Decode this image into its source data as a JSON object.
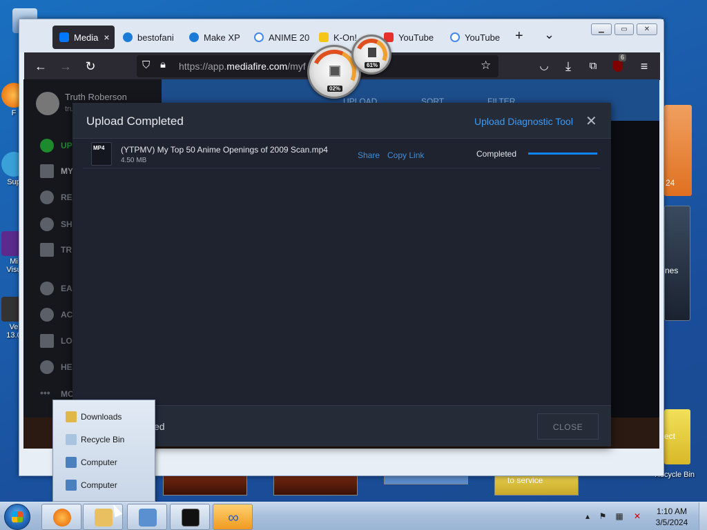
{
  "desktop": {
    "left_icons": [
      {
        "label": "Co",
        "name": "desktop-icon-computer"
      },
      {
        "label": "F",
        "name": "desktop-icon-firefox"
      },
      {
        "label": "Sup",
        "name": "desktop-icon-support"
      },
      {
        "label": "Mi\nVisu",
        "name": "desktop-icon-visual"
      },
      {
        "label": "Ve\n13.0",
        "name": "desktop-icon-ve"
      }
    ],
    "right_labels": {
      "calendar_year": "24",
      "gadget_text": "nes",
      "connect_text": "ect",
      "service_text": "to service",
      "recycle_bin": "Recycle Bin"
    }
  },
  "browser": {
    "tabs": [
      {
        "label": "Media",
        "active": true,
        "favicon_color": "#0077ff"
      },
      {
        "label": "bestofani",
        "active": false,
        "favicon_color": "#1a7bd8"
      },
      {
        "label": "Make XP",
        "active": false,
        "favicon_color": "#1a7bd8"
      },
      {
        "label": "ANIME 20",
        "active": false,
        "favicon_color": "#ffffff"
      },
      {
        "label": "K-On!",
        "active": false,
        "favicon_color": "#f5c518"
      },
      {
        "label": "YouTube",
        "active": false,
        "favicon_color": "#e8302a"
      },
      {
        "label": "YouTube",
        "active": false,
        "favicon_color": "#ffffff"
      }
    ],
    "tab_close_glyph": "×",
    "new_tab_glyph": "+",
    "list_tabs_glyph": "⌄",
    "url_prefix": "https://app.",
    "url_domain": "mediafire.com",
    "url_suffix": "/myf",
    "ublock_badge": "6",
    "window_buttons": {
      "minimize": "▁",
      "maximize": "▭",
      "close": "✕"
    }
  },
  "gauges": {
    "cpu_value": "02%",
    "mem_value": "61%"
  },
  "page": {
    "user_name": "Truth Roberson",
    "user_sub": "tru",
    "sidebar_items": [
      {
        "label": "UP",
        "name": "sidebar-item-upgrade"
      },
      {
        "label": "MY",
        "name": "sidebar-item-myfiles"
      },
      {
        "label": "RE",
        "name": "sidebar-item-recent"
      },
      {
        "label": "SH",
        "name": "sidebar-item-shared"
      },
      {
        "label": "TR",
        "name": "sidebar-item-trash"
      },
      {
        "label": "EA",
        "name": "sidebar-item-earn"
      },
      {
        "label": "AC",
        "name": "sidebar-item-account"
      },
      {
        "label": "LO",
        "name": "sidebar-item-logout"
      },
      {
        "label": "HE",
        "name": "sidebar-item-help"
      },
      {
        "label": "MO",
        "name": "sidebar-item-more"
      }
    ],
    "toolbar_labels": {
      "upload": "UPLOAD",
      "sort": "SORT",
      "filter": "FILTER"
    }
  },
  "modal": {
    "title": "Upload Completed",
    "diagnostic_link": "Upload Diagnostic Tool",
    "close_glyph": "✕",
    "file": {
      "type_badge": "MP4",
      "name": "(YTPMV) My Top 50 Anime Openings of 2009 Scan.mp4",
      "size": "4.50 MB",
      "share_label": "Share",
      "copy_link_label": "Copy Link",
      "status": "Completed",
      "progress_percent": 100
    },
    "footer_text": "ed",
    "close_button": "CLOSE"
  },
  "jumplist": {
    "items": [
      {
        "label": "Downloads",
        "icon_color": "#e0b84a"
      },
      {
        "label": "Recycle Bin",
        "icon_color": "#a8c4e0"
      },
      {
        "label": "Computer",
        "icon_color": "#4a7fc0"
      },
      {
        "label": "Computer",
        "icon_color": "#4a7fc0"
      }
    ]
  },
  "taskbar": {
    "items": [
      {
        "name": "taskbar-firefox",
        "color": "#e66000"
      },
      {
        "name": "taskbar-explorer",
        "color": "#e8c060"
      },
      {
        "name": "taskbar-remote-desktop",
        "color": "#5a8fd0"
      },
      {
        "name": "taskbar-cmd",
        "color": "#111111"
      },
      {
        "name": "taskbar-app",
        "color": "#f0a020"
      }
    ],
    "clock_time": "1:10 AM",
    "clock_date": "3/5/2024"
  }
}
